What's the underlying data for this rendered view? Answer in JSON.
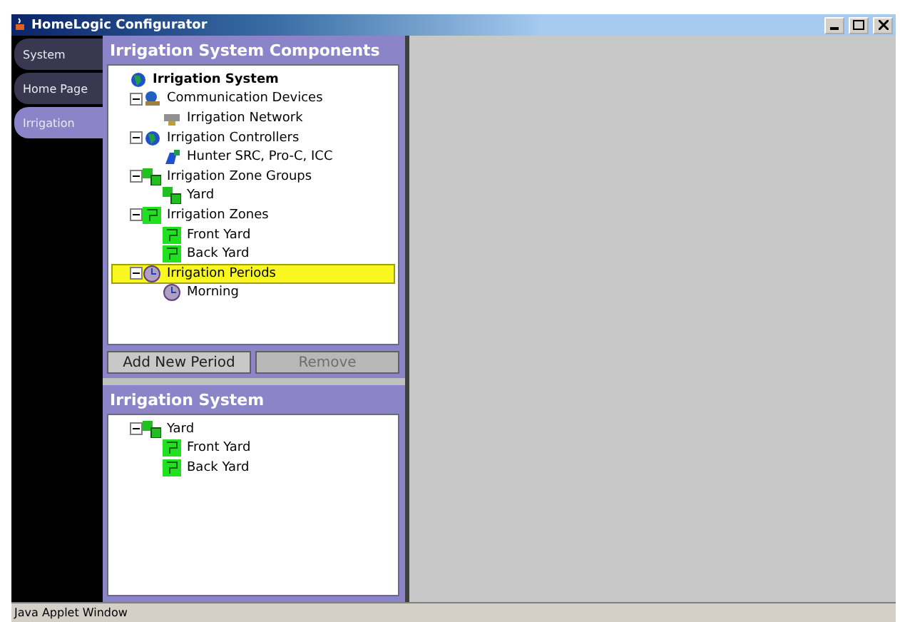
{
  "window": {
    "title": "HomeLogic Configurator"
  },
  "nav": [
    {
      "label": "System",
      "selected": false
    },
    {
      "label": "Home Page",
      "selected": false
    },
    {
      "label": "Irrigation",
      "selected": true
    }
  ],
  "components": {
    "title": "Irrigation System Components",
    "tree": [
      {
        "label": "Irrigation System",
        "kind": "system",
        "selected": false,
        "children": [
          {
            "label": "Communication Devices",
            "kind": "network",
            "expanded": true,
            "selected": false,
            "children": [
              {
                "label": "Irrigation Network",
                "kind": "device",
                "selected": false
              }
            ]
          },
          {
            "label": "Irrigation Controllers",
            "kind": "system",
            "expanded": true,
            "selected": false,
            "children": [
              {
                "label": "Hunter SRC, Pro-C, ICC",
                "kind": "controller",
                "selected": false
              }
            ]
          },
          {
            "label": "Irrigation Zone Groups",
            "kind": "group",
            "expanded": true,
            "selected": false,
            "children": [
              {
                "label": "Yard",
                "kind": "group",
                "selected": false
              }
            ]
          },
          {
            "label": "Irrigation Zones",
            "kind": "zone",
            "expanded": true,
            "selected": false,
            "children": [
              {
                "label": "Front Yard",
                "kind": "zone",
                "selected": false
              },
              {
                "label": "Back Yard",
                "kind": "zone",
                "selected": false
              }
            ]
          },
          {
            "label": "Irrigation Periods",
            "kind": "clock",
            "expanded": true,
            "selected": true,
            "children": [
              {
                "label": "Morning",
                "kind": "clock",
                "selected": false
              }
            ]
          }
        ]
      }
    ],
    "buttons": [
      {
        "label": "Add New Period",
        "disabled": false
      },
      {
        "label": "Remove",
        "disabled": true
      }
    ]
  },
  "system": {
    "title": "Irrigation System",
    "tree": [
      {
        "label": "Yard",
        "kind": "group",
        "expanded": true,
        "selected": false,
        "children": [
          {
            "label": "Front Yard",
            "kind": "zone",
            "selected": false
          },
          {
            "label": "Back Yard",
            "kind": "zone",
            "selected": false
          }
        ]
      }
    ]
  },
  "status_bar": "Java Applet Window"
}
